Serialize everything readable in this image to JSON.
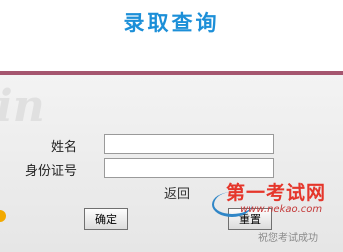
{
  "header": {
    "title": "录取查询"
  },
  "form": {
    "name_label": "姓名",
    "name_value": "",
    "id_label": "身份证号",
    "id_value": "",
    "back_label": "返回",
    "confirm_label": "确定",
    "reset_label": "重置"
  },
  "watermark": {
    "site_name": "第一考试网",
    "site_url": "www.nekao.com",
    "slogan": "祝您考试成功"
  },
  "colors": {
    "title": "#1c8fd8",
    "divider": "#a5566f",
    "watermark_red": "#e5362b"
  }
}
